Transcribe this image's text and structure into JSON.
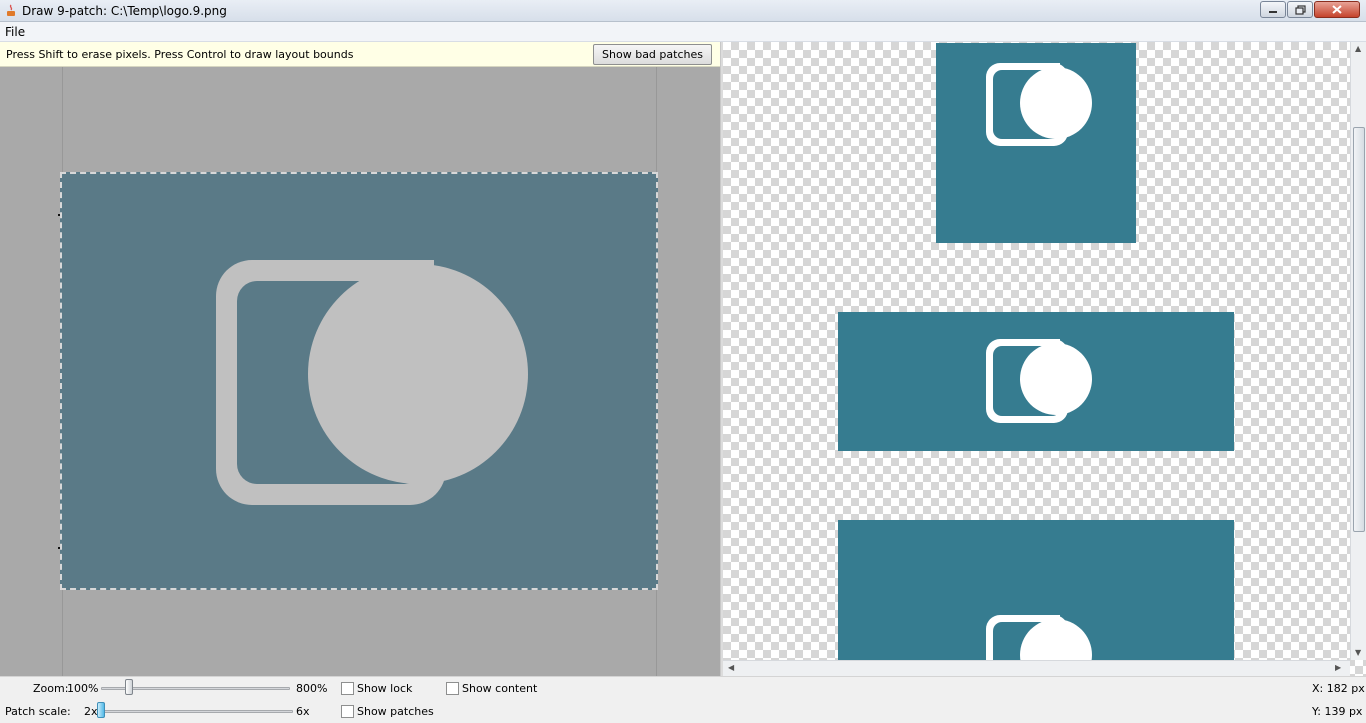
{
  "window": {
    "title": "Draw 9-patch: C:\\Temp\\logo.9.png",
    "minimize_icon": "minimize-icon",
    "maximize_icon": "restore-icon",
    "close_icon": "close-icon"
  },
  "menu": {
    "items": [
      "File"
    ]
  },
  "editor": {
    "hint": "Press Shift to erase pixels. Press Control to draw layout bounds",
    "bad_patches_label": "Show bad patches"
  },
  "controls": {
    "zoom_label": "Zoom:",
    "zoom_min": "100%",
    "zoom_max": "800%",
    "patch_scale_label": "Patch scale:",
    "patch_min": "2x",
    "patch_max": "6x",
    "show_lock": "Show lock",
    "show_patches": "Show patches",
    "show_content": "Show content",
    "zoom_value_fraction": 0.13,
    "patch_scale_fraction": 0.0
  },
  "status": {
    "x": "X: 182 px",
    "y": "Y: 139 px"
  },
  "colors": {
    "preview_fill": "#367c90",
    "editor_fill": "#5a7a87",
    "logo_editor": "#c0c0c0",
    "logo_preview": "#ffffff"
  }
}
